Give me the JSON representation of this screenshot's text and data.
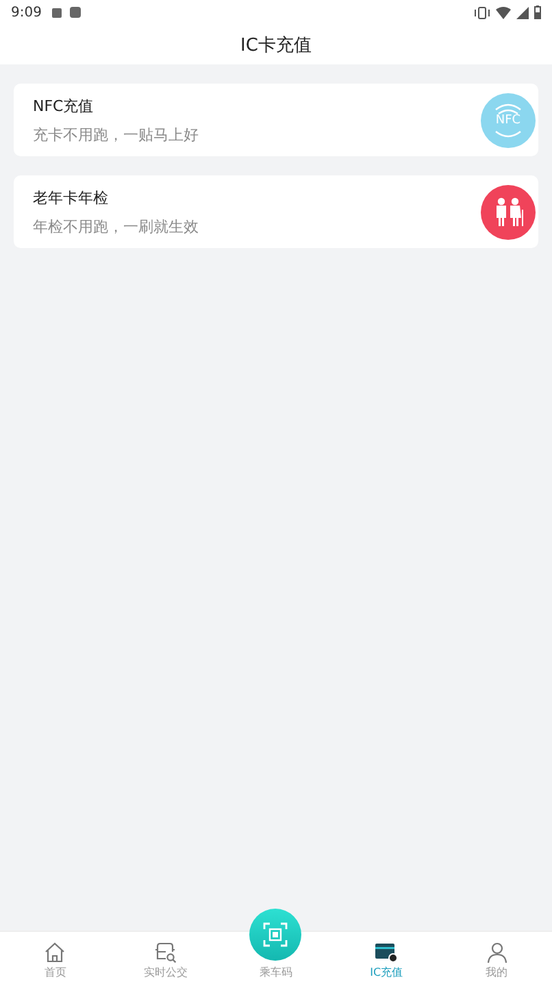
{
  "status_bar": {
    "time": "9:09"
  },
  "header": {
    "title": "IC卡充值"
  },
  "cards": [
    {
      "kind": "nfc",
      "title": "NFC充值",
      "subtitle": "充卡不用跑，一贴马上好",
      "badge": "NFC"
    },
    {
      "kind": "elderly",
      "title": "老年卡年检",
      "subtitle": "年检不用跑，一刷就生效"
    }
  ],
  "tabs": [
    {
      "kind": "home",
      "label": "首页",
      "selected": false
    },
    {
      "kind": "bus",
      "label": "实时公交",
      "selected": false
    },
    {
      "kind": "scan",
      "label": "乘车码",
      "selected": false
    },
    {
      "kind": "card",
      "label": "IC充值",
      "selected": true
    },
    {
      "kind": "user",
      "label": "我的",
      "selected": false
    }
  ]
}
